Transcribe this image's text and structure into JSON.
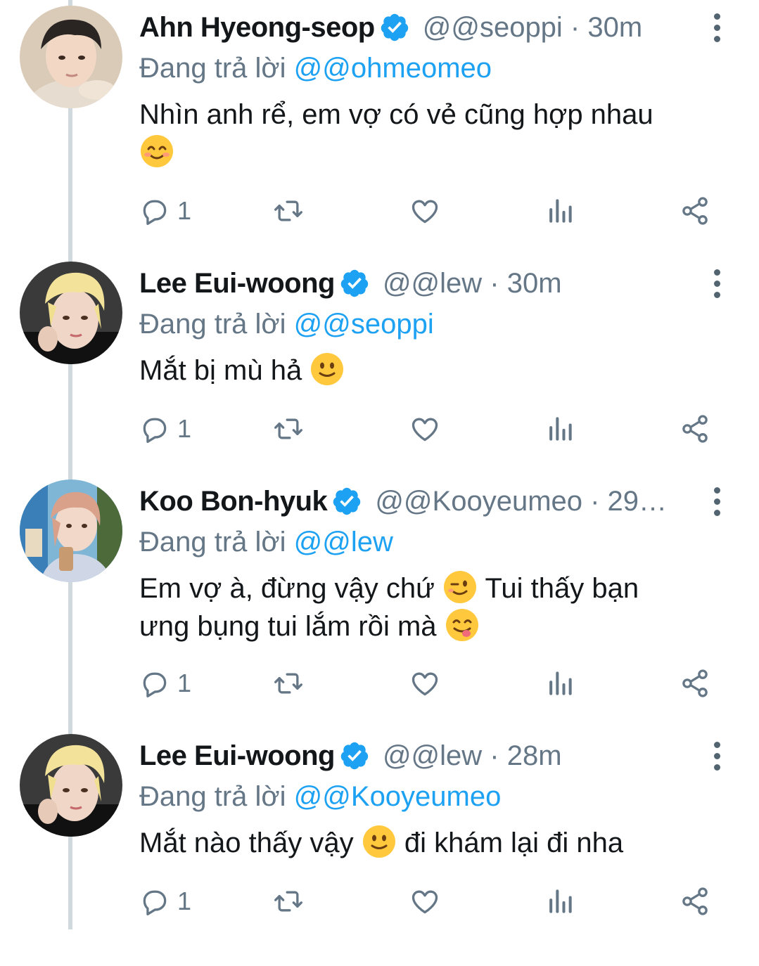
{
  "colors": {
    "accent": "#1da1f2",
    "secondary_text": "#657786",
    "primary_text": "#14171a",
    "thread_line": "#cfd9de"
  },
  "replying_prefix": "Đang trả lời",
  "tweets": [
    {
      "name": "Ahn Hyeong-seop",
      "handle_time": "@@seoppi · 30m",
      "reply_to": "@@ohmeomeo",
      "text_parts": [
        "Nhìn anh rể, em vợ có vẻ cũng hợp nhau"
      ],
      "emojis": [
        "smiling-face-with-smiling-eyes"
      ],
      "reply_count": "1",
      "avatar": "avatar-ahn"
    },
    {
      "name": "Lee Eui-woong",
      "handle_time": "@@lew · 30m",
      "reply_to": "@@seoppi",
      "text_parts": [
        "Mắt bị mù hả"
      ],
      "emojis": [
        "slightly-smiling-face"
      ],
      "reply_count": "1",
      "avatar": "avatar-lee"
    },
    {
      "name": "Koo Bon-hyuk",
      "handle_time": "@@Kooyeumeo · 29…",
      "reply_to": "@@lew",
      "text_parts": [
        "Em vợ à, đừng vậy chứ",
        "Tui thấy bạn ưng bụng tui lắm rồi mà"
      ],
      "emojis": [
        "winking-face",
        "face-savoring-food"
      ],
      "reply_count": "1",
      "avatar": "avatar-koo"
    },
    {
      "name": "Lee Eui-woong",
      "handle_time": "@@lew · 28m",
      "reply_to": "@@Kooyeumeo",
      "text_parts": [
        "Mắt nào thấy vậy",
        "đi khám lại đi nha"
      ],
      "emojis": [
        "slightly-smiling-face"
      ],
      "reply_count": "1",
      "avatar": "avatar-lee"
    }
  ]
}
